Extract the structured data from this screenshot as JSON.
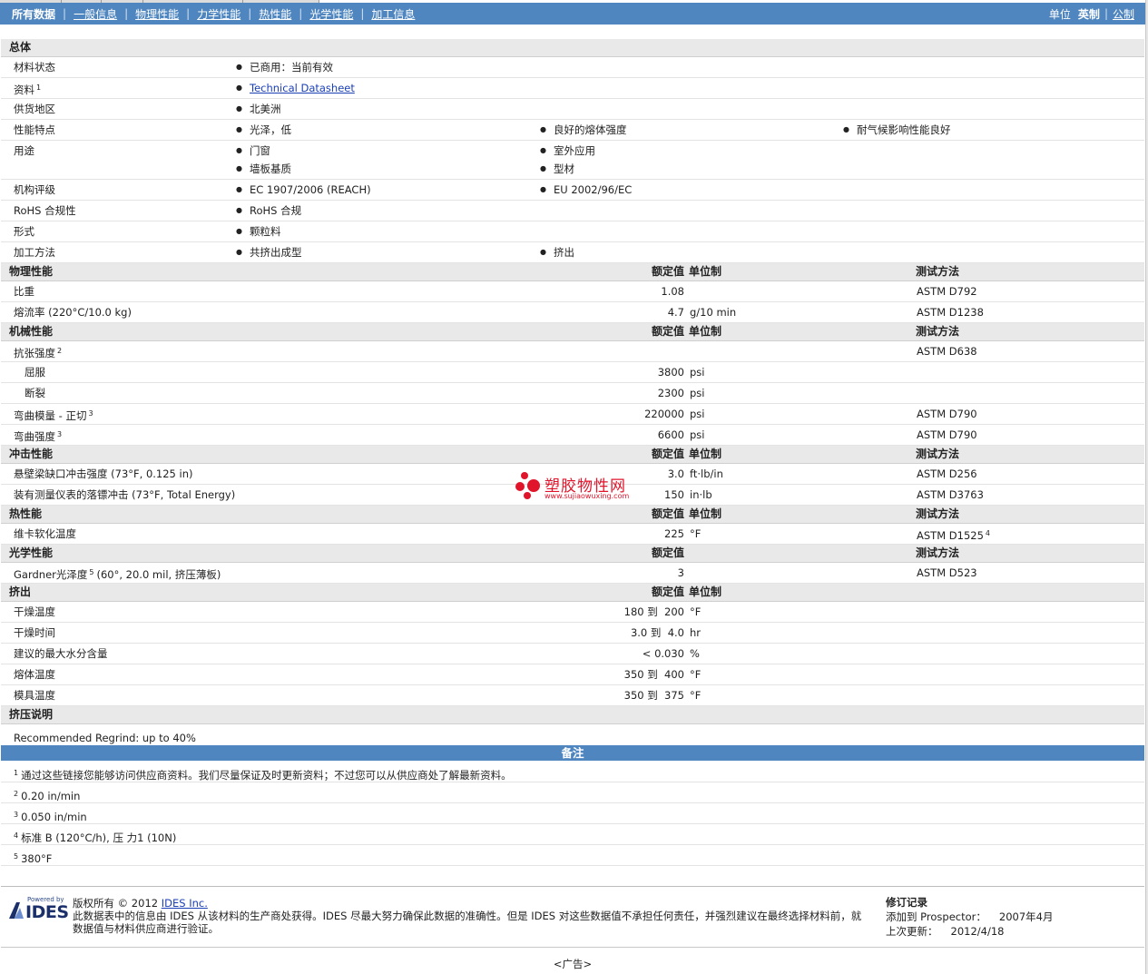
{
  "nav": {
    "tabs": [
      "所有数据",
      "一般信息",
      "物理性能",
      "力学性能",
      "热性能",
      "光学性能",
      "加工信息"
    ],
    "units_label": "单位",
    "unit_imperial": "英制",
    "unit_metric": "公制"
  },
  "general": {
    "title": "总体",
    "rows": [
      {
        "label": "材料状态",
        "sup": "",
        "items": [
          "已商用：当前有效"
        ]
      },
      {
        "label": "资料",
        "sup": "1",
        "items": [
          "Technical Datasheet"
        ],
        "link": true
      },
      {
        "label": "供货地区",
        "sup": "",
        "items": [
          "北美洲"
        ]
      },
      {
        "label": "性能特点",
        "sup": "",
        "items": [
          "光泽，低",
          "良好的熔体强度",
          "耐气候影响性能良好"
        ]
      },
      {
        "label": "用途",
        "sup": "",
        "items": [
          "门窗",
          "室外应用",
          "墙板基质",
          "型材"
        ],
        "two_line": true
      },
      {
        "label": "机构评级",
        "sup": "",
        "items": [
          "EC 1907/2006 (REACH)",
          "EU 2002/96/EC"
        ]
      },
      {
        "label": "RoHS 合规性",
        "sup": "",
        "items": [
          "RoHS 合规"
        ]
      },
      {
        "label": "形式",
        "sup": "",
        "items": [
          "颗粒料"
        ]
      },
      {
        "label": "加工方法",
        "sup": "",
        "items": [
          "共挤出成型",
          "挤出"
        ]
      }
    ]
  },
  "columns": {
    "value": "额定值",
    "unit": "单位制",
    "test": "测试方法"
  },
  "sections": [
    {
      "title": "物理性能",
      "show_unit": true,
      "show_test": true,
      "rows": [
        {
          "name": "比重",
          "sup": "",
          "value": "1.08",
          "unit": "",
          "test": "ASTM D792",
          "test_sup": ""
        },
        {
          "name": "熔流率 (220°C/10.0 kg)",
          "sup": "",
          "value": "4.7",
          "unit": "g/10 min",
          "test": "ASTM D1238",
          "test_sup": ""
        }
      ]
    },
    {
      "title": "机械性能",
      "show_unit": true,
      "show_test": true,
      "rows": [
        {
          "name": "抗张强度",
          "sup": "2",
          "value": "",
          "unit": "",
          "test": "ASTM D638",
          "test_sup": ""
        },
        {
          "name": "屈服",
          "sup": "",
          "value": "3800",
          "unit": "psi",
          "test": "",
          "test_sup": "",
          "sub": true
        },
        {
          "name": "断裂",
          "sup": "",
          "value": "2300",
          "unit": "psi",
          "test": "",
          "test_sup": "",
          "sub": true
        },
        {
          "name": "弯曲模量 - 正切",
          "sup": "3",
          "value": "220000",
          "unit": "psi",
          "test": "ASTM D790",
          "test_sup": ""
        },
        {
          "name": "弯曲强度",
          "sup": "3",
          "value": "6600",
          "unit": "psi",
          "test": "ASTM D790",
          "test_sup": ""
        }
      ]
    },
    {
      "title": "冲击性能",
      "show_unit": true,
      "show_test": true,
      "rows": [
        {
          "name": "悬壁梁缺口冲击强度 (73°F, 0.125 in)",
          "sup": "",
          "value": "3.0",
          "unit": "ft·lb/in",
          "test": "ASTM D256",
          "test_sup": ""
        },
        {
          "name": "装有测量仪表的落镖冲击 (73°F, Total Energy)",
          "sup": "",
          "value": "150",
          "unit": "in·lb",
          "test": "ASTM D3763",
          "test_sup": ""
        }
      ]
    },
    {
      "title": "热性能",
      "show_unit": true,
      "show_test": true,
      "rows": [
        {
          "name": "维卡软化温度",
          "sup": "",
          "value": "225",
          "unit": "°F",
          "test": "ASTM D1525",
          "test_sup": "4"
        }
      ]
    },
    {
      "title": "光学性能",
      "show_unit": false,
      "show_test": true,
      "rows": [
        {
          "name": "Gardner光泽度",
          "sup": "5",
          "name_tail": "(60°, 20.0 mil, 挤压薄板)",
          "value": "3",
          "unit": "",
          "test": "ASTM D523",
          "test_sup": ""
        }
      ]
    },
    {
      "title": "挤出",
      "show_unit": true,
      "show_test": false,
      "rows": [
        {
          "name": "干燥温度",
          "sup": "",
          "value": "180 到  200",
          "unit": "°F",
          "test": "",
          "test_sup": ""
        },
        {
          "name": "干燥时间",
          "sup": "",
          "value": "3.0 到  4.0",
          "unit": "hr",
          "test": "",
          "test_sup": ""
        },
        {
          "name": "建议的最大水分含量",
          "sup": "",
          "value": "< 0.030",
          "unit": "%",
          "test": "",
          "test_sup": ""
        },
        {
          "name": "熔体温度",
          "sup": "",
          "value": "350 到  400",
          "unit": "°F",
          "test": "",
          "test_sup": ""
        },
        {
          "name": "模具温度",
          "sup": "",
          "value": "350 到  375",
          "unit": "°F",
          "test": "",
          "test_sup": ""
        }
      ]
    },
    {
      "title": "挤压说明",
      "show_unit": false,
      "show_test": false,
      "show_value": false,
      "rows": [
        {
          "name": "Recommended Regrind: up to 40%",
          "sup": "",
          "value": "",
          "unit": "",
          "test": "",
          "test_sup": "",
          "tall": true
        }
      ]
    }
  ],
  "notes": {
    "title": "备注",
    "items": [
      {
        "n": "1",
        "text": "通过这些链接您能够访问供应商资料。我们尽量保证及时更新资料；不过您可以从供应商处了解最新资料。"
      },
      {
        "n": "2",
        "text": "0.20 in/min"
      },
      {
        "n": "3",
        "text": "0.050 in/min"
      },
      {
        "n": "4",
        "text": "标准 B (120°C/h), 压 力1 (10N)"
      },
      {
        "n": "5",
        "text": "380°F"
      }
    ]
  },
  "footer": {
    "logo_powered": "Powered by",
    "logo_text": "IDES",
    "copyright_prefix": "版权所有 © 2012",
    "copyright_link": "IDES Inc.",
    "disclaimer": "此数据表中的信息由 IDES 从该材料的生产商处获得。IDES 尽最大努力确保此数据的准确性。但是 IDES 对这些数据值不承担任何责任，并强烈建议在最终选择材料前，就数据值与材料供应商进行验证。",
    "rev_title": "修订记录",
    "rev_added_label": "添加到 Prospector：",
    "rev_added_value": "2007年4月",
    "rev_updated_label": "上次更新：",
    "rev_updated_value": "2012/4/18",
    "ad": "<广告>"
  },
  "watermark": {
    "title": "塑胶物性网",
    "url": "www.sujiaowuxing.com"
  },
  "colors": {
    "nav_bg": "#4f86bf",
    "section_bg": "#e9e9e9",
    "link": "#1a3fb5",
    "watermark": "#e0142b"
  }
}
